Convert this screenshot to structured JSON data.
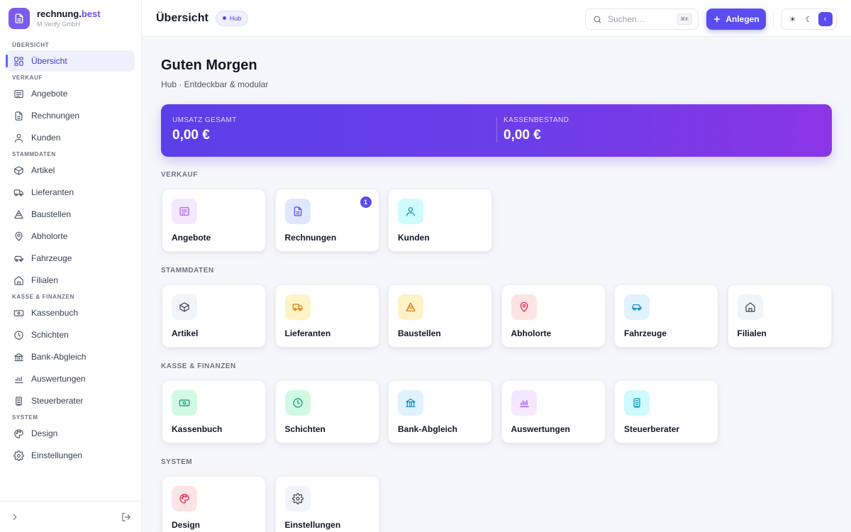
{
  "brand": {
    "name_main": "rechnung.",
    "name_accent": "best",
    "company": "M Verify GmbH"
  },
  "sidebar": {
    "sections": [
      {
        "label": "ÜBERSICHT"
      },
      {
        "label": "VERKAUF"
      },
      {
        "label": "STAMMDATEN"
      },
      {
        "label": "KASSE & FINANZEN"
      },
      {
        "label": "SYSTEM"
      }
    ],
    "items": [
      {
        "label": "Übersicht",
        "icon": "dashboard-icon"
      },
      {
        "label": "Angebote",
        "icon": "offer-icon"
      },
      {
        "label": "Rechnungen",
        "icon": "invoice-icon"
      },
      {
        "label": "Kunden",
        "icon": "user-icon"
      },
      {
        "label": "Artikel",
        "icon": "box-icon"
      },
      {
        "label": "Lieferanten",
        "icon": "truck-icon"
      },
      {
        "label": "Baustellen",
        "icon": "construction-icon"
      },
      {
        "label": "Abholorte",
        "icon": "pin-icon"
      },
      {
        "label": "Fahrzeuge",
        "icon": "car-icon"
      },
      {
        "label": "Filialen",
        "icon": "store-icon"
      },
      {
        "label": "Kassenbuch",
        "icon": "cash-icon"
      },
      {
        "label": "Schichten",
        "icon": "clock-icon"
      },
      {
        "label": "Bank-Abgleich",
        "icon": "bank-icon"
      },
      {
        "label": "Auswertungen",
        "icon": "chart-icon"
      },
      {
        "label": "Steuerberater",
        "icon": "calculator-icon"
      },
      {
        "label": "Design",
        "icon": "palette-icon"
      },
      {
        "label": "Einstellungen",
        "icon": "gear-icon"
      }
    ]
  },
  "header": {
    "title": "Übersicht",
    "badge": "Hub",
    "search_placeholder": "Suchen…",
    "search_shortcut": "⌘K",
    "create_label": "Anlegen",
    "theme": {
      "light": "☀",
      "dark": "☾",
      "system": "‹"
    }
  },
  "main": {
    "greeting": "Guten Morgen",
    "subtitle": "Hub · Entdeckbar & modular",
    "stats": [
      {
        "label": "UMSATZ GESAMT",
        "value": "0,00 €"
      },
      {
        "label": "KASSENBESTAND",
        "value": "0,00 €"
      }
    ],
    "groups": [
      {
        "label": "VERKAUF",
        "cards": [
          {
            "label": "Angebote",
            "icon": "offer-icon",
            "color": "#a855f7",
            "bg": "#f3e8ff"
          },
          {
            "label": "Rechnungen",
            "icon": "invoice-icon",
            "color": "#4f46e5",
            "bg": "#e0e7ff",
            "badge": "1"
          },
          {
            "label": "Kunden",
            "icon": "user-icon",
            "color": "#0891b2",
            "bg": "#cffafe"
          }
        ]
      },
      {
        "label": "STAMMDATEN",
        "cards": [
          {
            "label": "Artikel",
            "icon": "box-icon",
            "color": "#374151",
            "bg": "#f1f5f9"
          },
          {
            "label": "Lieferanten",
            "icon": "truck-icon",
            "color": "#d97706",
            "bg": "#fef3c7"
          },
          {
            "label": "Baustellen",
            "icon": "construction-icon",
            "color": "#d97706",
            "bg": "#fef3c7"
          },
          {
            "label": "Abholorte",
            "icon": "pin-icon",
            "color": "#e11d48",
            "bg": "#ffe4e6"
          },
          {
            "label": "Fahrzeuge",
            "icon": "car-icon",
            "color": "#0284c7",
            "bg": "#e0f2fe"
          },
          {
            "label": "Filialen",
            "icon": "store-icon",
            "color": "#374151",
            "bg": "#f1f5f9"
          }
        ]
      },
      {
        "label": "KASSE & FINANZEN",
        "cards": [
          {
            "label": "Kassenbuch",
            "icon": "cash-icon",
            "color": "#059669",
            "bg": "#d1fae5"
          },
          {
            "label": "Schichten",
            "icon": "clock-icon",
            "color": "#059669",
            "bg": "#d1fae5"
          },
          {
            "label": "Bank-Abgleich",
            "icon": "bank-icon",
            "color": "#0284c7",
            "bg": "#e0f2fe"
          },
          {
            "label": "Auswertungen",
            "icon": "chart-icon",
            "color": "#9333ea",
            "bg": "#f3e8ff"
          },
          {
            "label": "Steuerberater",
            "icon": "calculator-icon",
            "color": "#0891b2",
            "bg": "#cffafe"
          }
        ]
      },
      {
        "label": "SYSTEM",
        "cards": [
          {
            "label": "Design",
            "icon": "palette-icon",
            "color": "#e11d48",
            "bg": "#ffe4e6"
          },
          {
            "label": "Einstellungen",
            "icon": "gear-icon",
            "color": "#374151",
            "bg": "#f1f5f9"
          }
        ]
      }
    ]
  }
}
